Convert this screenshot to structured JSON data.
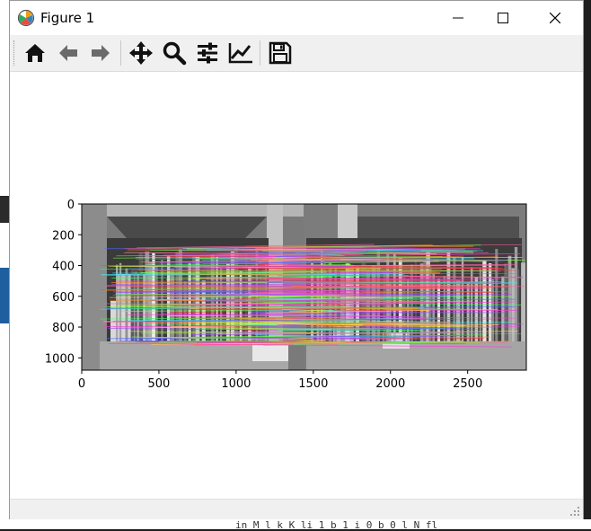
{
  "window": {
    "title": "Figure 1"
  },
  "toolbar": {
    "buttons": [
      {
        "name": "home-icon"
      },
      {
        "name": "back-arrow-icon"
      },
      {
        "name": "forward-arrow-icon"
      },
      {
        "name": "pan-move-icon"
      },
      {
        "name": "zoom-magnifier-icon"
      },
      {
        "name": "configure-subplots-icon"
      },
      {
        "name": "edit-axis-icon"
      },
      {
        "name": "save-floppy-icon"
      }
    ]
  },
  "plot": {
    "x_ticks": [
      "0",
      "500",
      "1000",
      "1500",
      "2000",
      "2500"
    ],
    "y_ticks": [
      "0",
      "200",
      "400",
      "600",
      "800",
      "1000"
    ],
    "xlim": [
      0,
      2880
    ],
    "ylim": [
      1080,
      0
    ]
  },
  "background_text": {
    "bottom_line": "    in  M  l  k  K  li  1 b 1 i  0  b 0  l N  fl"
  },
  "colors": {
    "accent_blue": "#1f5f9f",
    "window_bg": "#ffffff",
    "toolbar_bg": "#f0f0f0"
  }
}
